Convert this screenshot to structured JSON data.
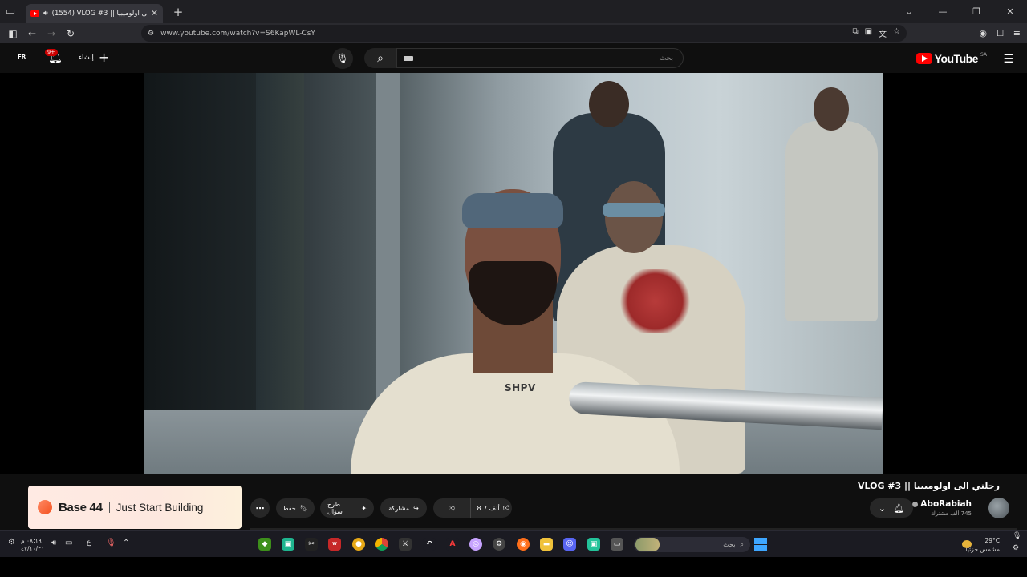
{
  "browser": {
    "tab_title": "(1554) VLOG #3 || رحلتي الى اولوميبيا",
    "url": "www.youtube.com/watch?v=S6KapWL-CsY"
  },
  "youtube": {
    "logo_text": "YouTube",
    "region": "SA",
    "search_placeholder": "بحث",
    "create_label": "إنشاء",
    "notifications_badge": "9+",
    "avatar_label": "FR"
  },
  "video": {
    "shirt_text": "SHPV",
    "title": "رحلتي الى اولوميبيا || VLOG #3",
    "channel_name": "AboRabiah",
    "subscribers": "745 ألف مشترك",
    "likes": "8.7 ألف",
    "share_label": "مشاركة",
    "ask_label": "طرح سؤال",
    "save_label": "حفظ"
  },
  "ad": {
    "brand": "Base 44",
    "tagline": "Just Start Building"
  },
  "taskbar": {
    "search_placeholder": "بحث",
    "temperature": "29°C",
    "weather": "مشمس جزئيًا",
    "time": "٠٨:١٩ م",
    "date": "٤٧/١٠/٢١",
    "lang": "ع",
    "icons": [
      "nvidia-icon",
      "app-icon",
      "capcut-icon",
      "writer-icon",
      "chrome-icon-a",
      "chrome-icon",
      "game-icon",
      "arrow-app-icon",
      "adobe-icon",
      "circle-app-icon",
      "steam-icon",
      "firefox-icon",
      "folder-icon",
      "discord-icon",
      "app-green-icon",
      "window-app-icon"
    ]
  },
  "colors": {
    "youtube_red": "#ff0000",
    "background": "#0f0f0f",
    "pill": "#272727",
    "windows_blue": "#3ea6ff"
  }
}
